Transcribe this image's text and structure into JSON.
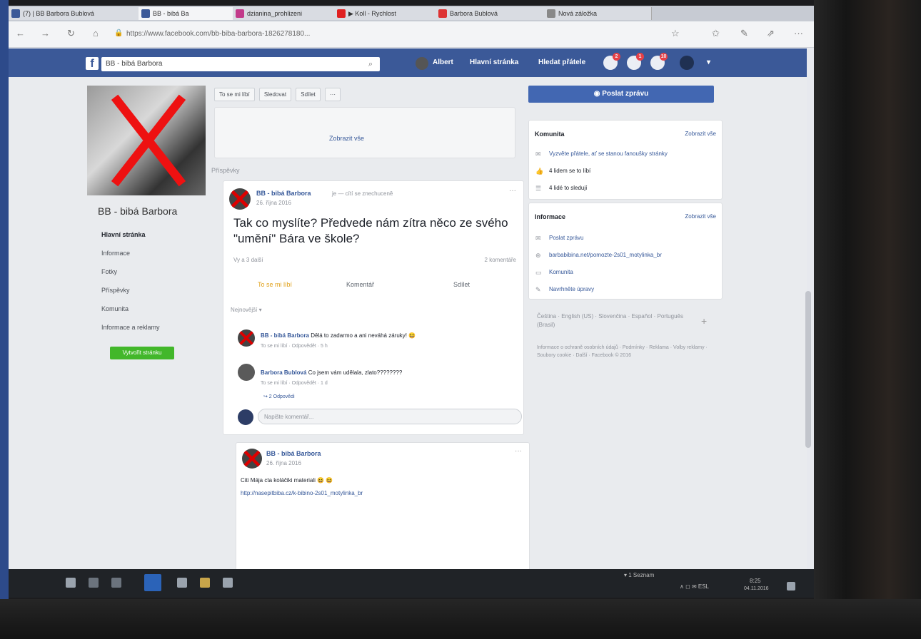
{
  "browser": {
    "tabs": [
      {
        "label": "(7) | BB Barbora Bublová"
      },
      {
        "label": "BB - bibá Ba"
      },
      {
        "label": "dzianina_prohlizeni"
      },
      {
        "label": "▶ Koll - Rychlost"
      },
      {
        "label": "Barbora Bublová"
      },
      {
        "label": "Nová záložka"
      }
    ],
    "url": "https://www.facebook.com/bb-biba-barbora-1826278180..."
  },
  "facebook": {
    "logo": "f",
    "search_value": "BB - bibá Barbora",
    "nav": [
      "Albert",
      "Hlavní stránka",
      "Hledat přátele"
    ],
    "badges": [
      "2",
      "1",
      "10"
    ]
  },
  "left": {
    "page_name": "BB - bibá Barbora",
    "nav": [
      "Hlavní stránka",
      "Informace",
      "Fotky",
      "Příspěvky",
      "Komunita",
      "Informace a reklamy"
    ],
    "create_page_button": "Vytvořit stránku"
  },
  "center": {
    "actions": [
      "To se mi líbí",
      "Sledovat",
      "Sdílet",
      "···"
    ],
    "see_more": "Zobrazit vše",
    "section_title": "Příspěvky",
    "post1": {
      "author": "BB - bibá Barbora",
      "feeling": "je — cítí se znechuceně",
      "date": "26. října 2016",
      "text": "Tak co myslíte? Předvede nám zítra něco ze svého \"umění\" Bára ve škole?",
      "reactions": "Vy a 3 další",
      "comments_count": "2 komentáře",
      "like": "To se mi líbí",
      "comment": "Komentář",
      "share": "Sdílet",
      "sort": "Nejnovější ▾",
      "comment1_author": "BB - bibá Barbora",
      "comment1_text": "Dělá to zadarmo a ani neváhá záruky! 😆",
      "comment1_meta": "To se mi líbí · Odpovědět · 5 h",
      "comment2_author": "Barbora Bublová",
      "comment2_text": "Co jsem vám udělala, zlato????????",
      "comment2_meta": "To se mi líbí · Odpovědět · 1 d",
      "replies": "↪ 2 Odpovědi",
      "write_placeholder": "Napište komentář..."
    },
    "post2": {
      "author": "BB - bibá Barbora",
      "date": "26. října 2016",
      "text": "Citi Mája cta koláčiki materiali 😆 😆",
      "link": "http://nasepitbiba.cz/k-bibino-2s01_motylinka_br"
    }
  },
  "right": {
    "message_button": "Poslat zprávu",
    "community": {
      "title": "Komunita",
      "see_all": "Zobrazit vše",
      "items": [
        "Vyzvěte přátele, ať se stanou fanoušky stránky",
        "4 lidem se to líbí",
        "4 lidé to sledují"
      ]
    },
    "info": {
      "title": "Informace",
      "see_all": "Zobrazit vše",
      "items": [
        "Poslat zprávu",
        "barbabibina.net/pomozte-2s01_motylinka_br",
        "Komunita",
        "Navrhněte úpravy"
      ]
    },
    "languages": "Čeština · English (US) · Slovenčina · Español · Português (Brasil)",
    "footer": "Informace o ochraně osobních údajů · Podmínky · Reklama · Volby reklamy · Soubory cookie · Další · Facebook © 2016"
  },
  "taskbar": {
    "tray_text": "∧ ◻ ✉ ESL",
    "time": "8:25",
    "date": "04.11.2016",
    "left_label": "▾ 1 Seznam"
  }
}
